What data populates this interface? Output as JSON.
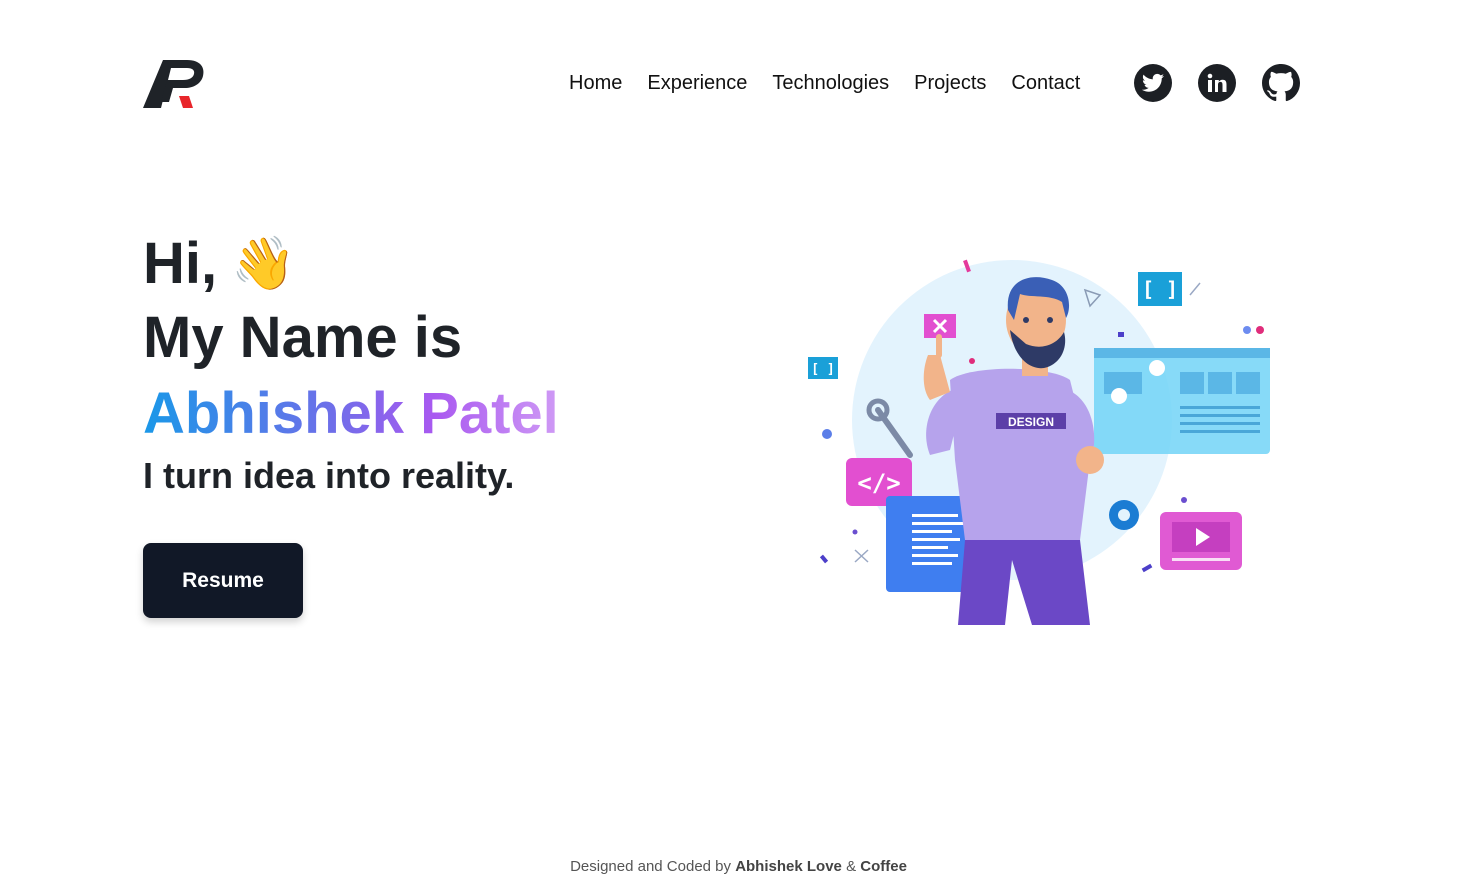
{
  "header": {
    "logo_icon": "ap-monogram-logo",
    "nav": [
      "Home",
      "Experience",
      "Technologies",
      "Projects",
      "Contact"
    ],
    "socials": [
      {
        "name": "twitter",
        "icon": "twitter-icon"
      },
      {
        "name": "linkedin",
        "icon": "linkedin-icon"
      },
      {
        "name": "github",
        "icon": "github-icon"
      }
    ]
  },
  "hero": {
    "greeting": "Hi,",
    "wave_emoji": "👋",
    "name_intro": "My Name is",
    "full_name": "Abhishek Patel",
    "tagline": "I turn idea into reality.",
    "resume_label": "Resume",
    "illustration_label": "DESIGN"
  },
  "footer": {
    "prefix": "Designed and Coded by",
    "author": "Abhishek Love",
    "amp": "&",
    "coffee": "Coffee"
  },
  "colors": {
    "text_dark": "#1f2328",
    "button_bg": "#111827",
    "gradient_start": "#1a98e8",
    "gradient_end": "#cf9af5"
  }
}
